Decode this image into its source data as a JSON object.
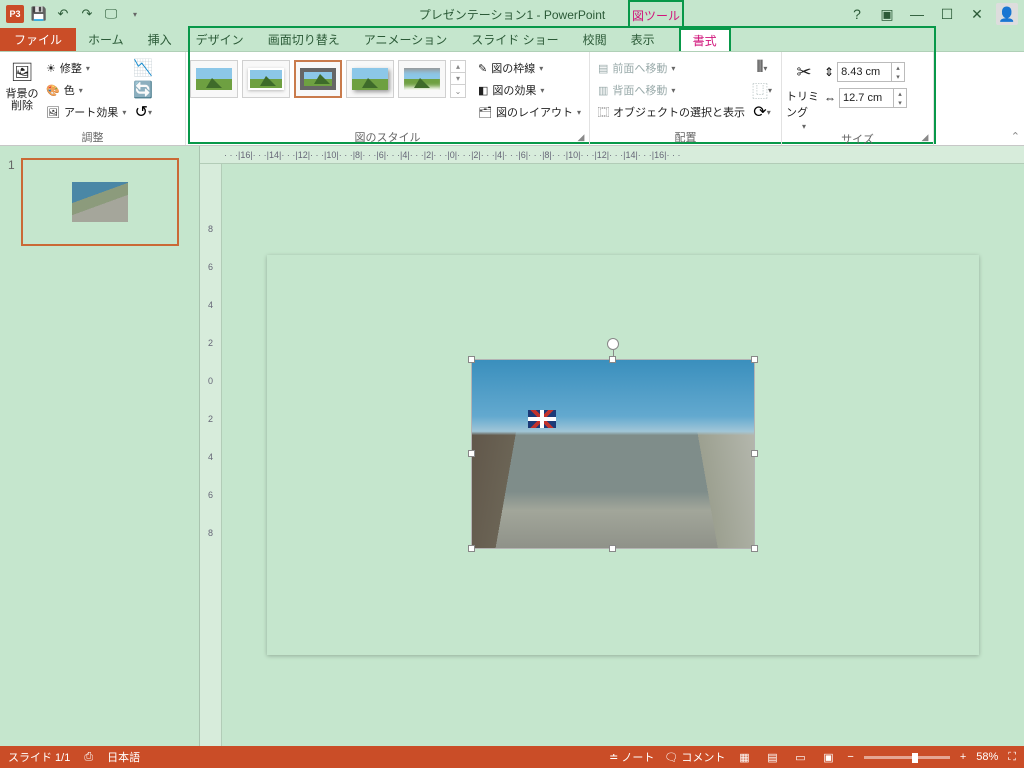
{
  "app_icon": "P3",
  "title": "プレゼンテーション1 - PowerPoint",
  "tool_tab": "図ツール",
  "tabs": {
    "file": "ファイル",
    "home": "ホーム",
    "insert": "挿入",
    "design": "デザイン",
    "transition": "画面切り替え",
    "animation": "アニメーション",
    "slideshow": "スライド ショー",
    "review": "校閲",
    "view": "表示",
    "format": "書式"
  },
  "groups": {
    "adjust": {
      "label": "調整",
      "remove_bg": "背景の\n削除",
      "corrections": "修整",
      "color": "色",
      "artistic": "アート効果"
    },
    "styles": {
      "label": "図のスタイル",
      "outline": "図の枠線",
      "effects": "図の効果",
      "layout": "図のレイアウト"
    },
    "arrange": {
      "label": "配置",
      "bring_fwd": "前面へ移動",
      "send_back": "背面へ移動",
      "selection_pane": "オブジェクトの選択と表示"
    },
    "size": {
      "label": "サイズ",
      "trim": "トリミング",
      "height": "8.43 cm",
      "width": "12.7 cm"
    }
  },
  "ruler_h": "· · ·|16|· · ·|14|· · ·|12|· · ·|10|· · ·|8|· · ·|6|· · ·|4|· · ·|2|· · ·|0|· · ·|2|· · ·|4|· · ·|6|· · ·|8|· · ·|10|· · ·|12|· · ·|14|· · ·|16|· · ·",
  "ruler_v": [
    "8",
    "6",
    "4",
    "2",
    "0",
    "2",
    "4",
    "6",
    "8"
  ],
  "thumb_num": "1",
  "status": {
    "slide": "スライド 1/1",
    "lang": "日本語",
    "notes": "ノート",
    "comments": "コメント",
    "zoom": "58%"
  }
}
